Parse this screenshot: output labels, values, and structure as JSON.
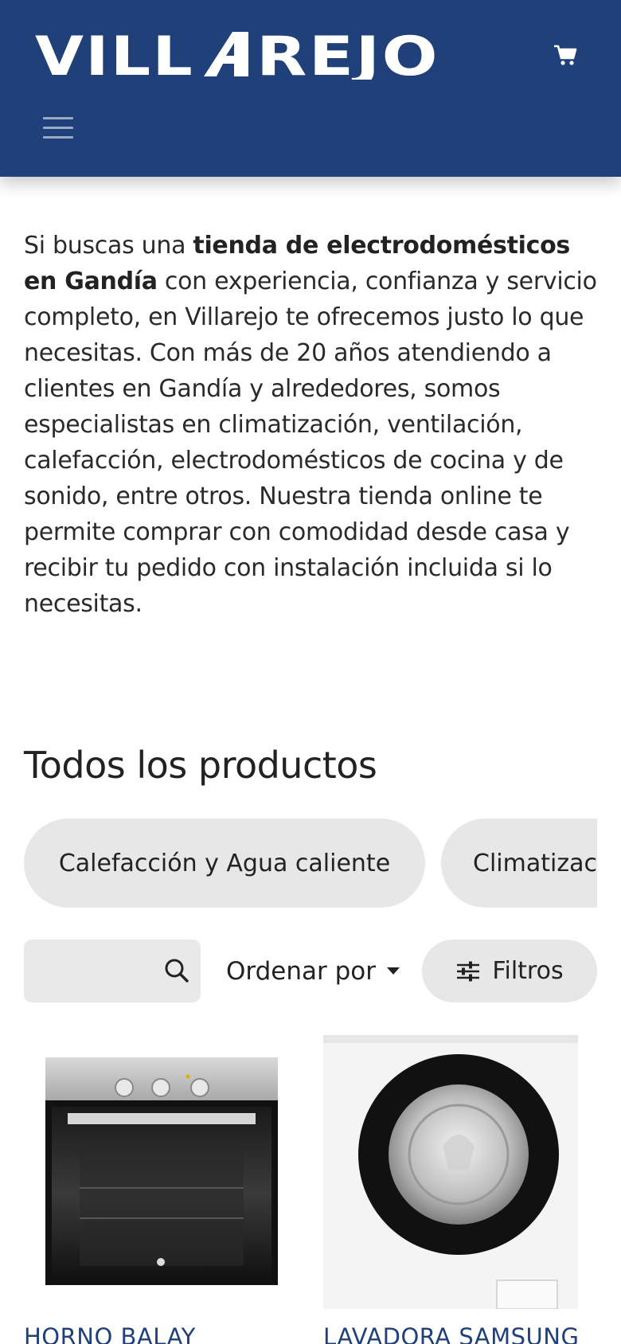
{
  "header": {
    "brand": "VILLAREJO",
    "cart_icon": "shopping-cart-icon",
    "menu_icon": "hamburger-menu-icon",
    "background": "#1f4079"
  },
  "intro": {
    "part1": "Si buscas una ",
    "bold1": "tienda de electrodomésticos en Gandía",
    "part2": " con experiencia, confianza y servicio completo, en Villarejo te ofrecemos justo lo que necesitas. Con más de 20 años atendiendo a clientes en Gandía y alrededores, somos especialistas en climatización, ventilación, calefacción, electrodomésticos de cocina y de sonido, entre otros. Nuestra tienda online te permite comprar con comodidad desde casa y recibir tu pedido con instalación incluida si lo necesitas."
  },
  "products_section": {
    "title": "Todos los productos",
    "categories": [
      "Calefacción y Agua caliente",
      "Climatización"
    ],
    "search": {
      "value": "",
      "placeholder": "",
      "icon": "search-icon"
    },
    "sort_label": "Ordenar por",
    "filters_label": "Filtros",
    "products": [
      {
        "name": "HORNO BALAY",
        "image": "oven-image"
      },
      {
        "name": "LAVADORA SAMSUNG",
        "image": "washing-machine-image"
      }
    ]
  },
  "colors": {
    "brand_blue": "#1f4079",
    "pill_grey": "#e7e7e7",
    "link_blue": "#1f4079"
  }
}
